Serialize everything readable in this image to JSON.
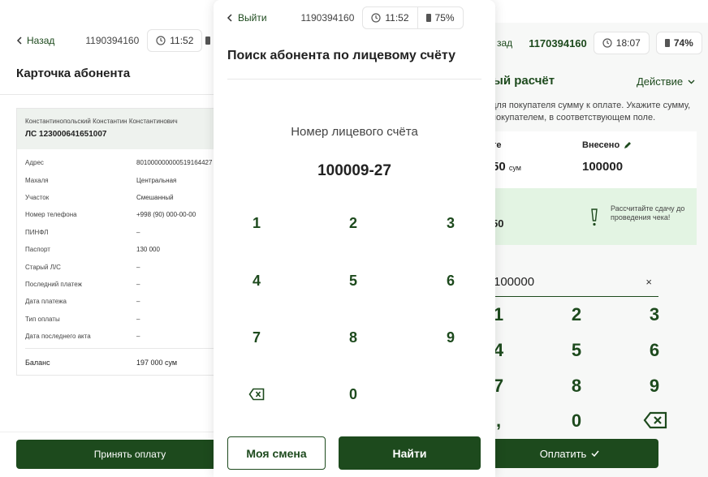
{
  "left": {
    "back_label": "Назад",
    "account": "1190394160",
    "time": "11:52",
    "title": "Карточка абонента",
    "owner": "Константинопольский Константин Константинович",
    "ls": "ЛС 123000641651007",
    "rows": [
      {
        "k": "Адрес",
        "v": "801000000000519164427"
      },
      {
        "k": "Махаля",
        "v": "Центральная"
      },
      {
        "k": "Участок",
        "v": "Смешанный"
      },
      {
        "k": "Номер телефона",
        "v": "+998 (90) 000-00-00"
      },
      {
        "k": "ПИНФЛ",
        "v": "–"
      },
      {
        "k": "Паспорт",
        "v": "130 000"
      },
      {
        "k": "Старый Л/С",
        "v": "–"
      },
      {
        "k": "Последний платеж",
        "v": "–"
      },
      {
        "k": "Дата платежа",
        "v": "–"
      },
      {
        "k": "Тип оплаты",
        "v": "–"
      },
      {
        "k": "Дата последнего акта",
        "v": "–"
      }
    ],
    "balance_label": "Баланс",
    "balance_value": "197 000 сум",
    "pay_button": "Принять оплату"
  },
  "center": {
    "back_label": "Выйти",
    "account": "1190394160",
    "time": "11:52",
    "battery": "75%",
    "title": "Поиск абонента по лицевому счёту",
    "number_label": "Номер лицевого счёта",
    "number_value": "100009-27",
    "keys": [
      "1",
      "2",
      "3",
      "4",
      "5",
      "6",
      "7",
      "8",
      "9",
      "0"
    ],
    "shift_button": "Моя смена",
    "find_button": "Найти"
  },
  "right": {
    "back_label": "зад",
    "account": "1170394160",
    "time": "18:07",
    "battery": "74%",
    "title": "ный расчёт",
    "action": "Действие",
    "hint": "для покупателя сумму к оплате. Укажите сумму, покупателем, в соответствующем поле.",
    "col1_label": "те",
    "col1_value": "50",
    "col1_unit": "сум",
    "col2_label": "Внесено",
    "col2_value": "100000",
    "green_value": "50",
    "green_text": "Рассчитайте сдачу до проведения чека!",
    "input_value": "100000",
    "clear": "×",
    "keys": [
      "1",
      "2",
      "3",
      "4",
      "5",
      "6",
      "7",
      "8",
      "9",
      ",",
      "0"
    ],
    "pay_button": "Оплатить"
  },
  "colors": {
    "accent": "#1d4a1d",
    "light_green": "#e3f4e3"
  }
}
